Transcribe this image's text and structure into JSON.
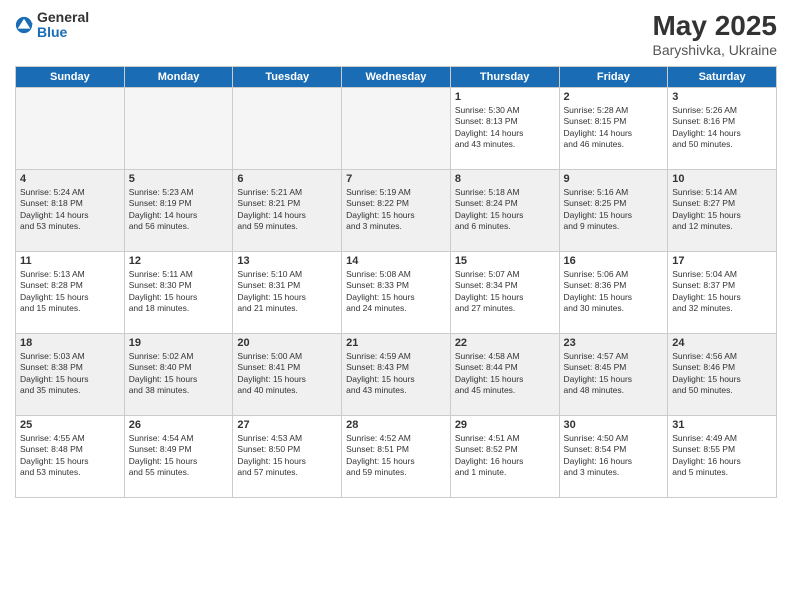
{
  "header": {
    "logo_general": "General",
    "logo_blue": "Blue",
    "month": "May 2025",
    "location": "Baryshivka, Ukraine"
  },
  "days_of_week": [
    "Sunday",
    "Monday",
    "Tuesday",
    "Wednesday",
    "Thursday",
    "Friday",
    "Saturday"
  ],
  "weeks": [
    [
      {
        "day": "",
        "info": "",
        "empty": true
      },
      {
        "day": "",
        "info": "",
        "empty": true
      },
      {
        "day": "",
        "info": "",
        "empty": true
      },
      {
        "day": "",
        "info": "",
        "empty": true
      },
      {
        "day": "1",
        "info": "Sunrise: 5:30 AM\nSunset: 8:13 PM\nDaylight: 14 hours\nand 43 minutes.",
        "empty": false
      },
      {
        "day": "2",
        "info": "Sunrise: 5:28 AM\nSunset: 8:15 PM\nDaylight: 14 hours\nand 46 minutes.",
        "empty": false
      },
      {
        "day": "3",
        "info": "Sunrise: 5:26 AM\nSunset: 8:16 PM\nDaylight: 14 hours\nand 50 minutes.",
        "empty": false
      }
    ],
    [
      {
        "day": "4",
        "info": "Sunrise: 5:24 AM\nSunset: 8:18 PM\nDaylight: 14 hours\nand 53 minutes.",
        "empty": false
      },
      {
        "day": "5",
        "info": "Sunrise: 5:23 AM\nSunset: 8:19 PM\nDaylight: 14 hours\nand 56 minutes.",
        "empty": false
      },
      {
        "day": "6",
        "info": "Sunrise: 5:21 AM\nSunset: 8:21 PM\nDaylight: 14 hours\nand 59 minutes.",
        "empty": false
      },
      {
        "day": "7",
        "info": "Sunrise: 5:19 AM\nSunset: 8:22 PM\nDaylight: 15 hours\nand 3 minutes.",
        "empty": false
      },
      {
        "day": "8",
        "info": "Sunrise: 5:18 AM\nSunset: 8:24 PM\nDaylight: 15 hours\nand 6 minutes.",
        "empty": false
      },
      {
        "day": "9",
        "info": "Sunrise: 5:16 AM\nSunset: 8:25 PM\nDaylight: 15 hours\nand 9 minutes.",
        "empty": false
      },
      {
        "day": "10",
        "info": "Sunrise: 5:14 AM\nSunset: 8:27 PM\nDaylight: 15 hours\nand 12 minutes.",
        "empty": false
      }
    ],
    [
      {
        "day": "11",
        "info": "Sunrise: 5:13 AM\nSunset: 8:28 PM\nDaylight: 15 hours\nand 15 minutes.",
        "empty": false
      },
      {
        "day": "12",
        "info": "Sunrise: 5:11 AM\nSunset: 8:30 PM\nDaylight: 15 hours\nand 18 minutes.",
        "empty": false
      },
      {
        "day": "13",
        "info": "Sunrise: 5:10 AM\nSunset: 8:31 PM\nDaylight: 15 hours\nand 21 minutes.",
        "empty": false
      },
      {
        "day": "14",
        "info": "Sunrise: 5:08 AM\nSunset: 8:33 PM\nDaylight: 15 hours\nand 24 minutes.",
        "empty": false
      },
      {
        "day": "15",
        "info": "Sunrise: 5:07 AM\nSunset: 8:34 PM\nDaylight: 15 hours\nand 27 minutes.",
        "empty": false
      },
      {
        "day": "16",
        "info": "Sunrise: 5:06 AM\nSunset: 8:36 PM\nDaylight: 15 hours\nand 30 minutes.",
        "empty": false
      },
      {
        "day": "17",
        "info": "Sunrise: 5:04 AM\nSunset: 8:37 PM\nDaylight: 15 hours\nand 32 minutes.",
        "empty": false
      }
    ],
    [
      {
        "day": "18",
        "info": "Sunrise: 5:03 AM\nSunset: 8:38 PM\nDaylight: 15 hours\nand 35 minutes.",
        "empty": false
      },
      {
        "day": "19",
        "info": "Sunrise: 5:02 AM\nSunset: 8:40 PM\nDaylight: 15 hours\nand 38 minutes.",
        "empty": false
      },
      {
        "day": "20",
        "info": "Sunrise: 5:00 AM\nSunset: 8:41 PM\nDaylight: 15 hours\nand 40 minutes.",
        "empty": false
      },
      {
        "day": "21",
        "info": "Sunrise: 4:59 AM\nSunset: 8:43 PM\nDaylight: 15 hours\nand 43 minutes.",
        "empty": false
      },
      {
        "day": "22",
        "info": "Sunrise: 4:58 AM\nSunset: 8:44 PM\nDaylight: 15 hours\nand 45 minutes.",
        "empty": false
      },
      {
        "day": "23",
        "info": "Sunrise: 4:57 AM\nSunset: 8:45 PM\nDaylight: 15 hours\nand 48 minutes.",
        "empty": false
      },
      {
        "day": "24",
        "info": "Sunrise: 4:56 AM\nSunset: 8:46 PM\nDaylight: 15 hours\nand 50 minutes.",
        "empty": false
      }
    ],
    [
      {
        "day": "25",
        "info": "Sunrise: 4:55 AM\nSunset: 8:48 PM\nDaylight: 15 hours\nand 53 minutes.",
        "empty": false
      },
      {
        "day": "26",
        "info": "Sunrise: 4:54 AM\nSunset: 8:49 PM\nDaylight: 15 hours\nand 55 minutes.",
        "empty": false
      },
      {
        "day": "27",
        "info": "Sunrise: 4:53 AM\nSunset: 8:50 PM\nDaylight: 15 hours\nand 57 minutes.",
        "empty": false
      },
      {
        "day": "28",
        "info": "Sunrise: 4:52 AM\nSunset: 8:51 PM\nDaylight: 15 hours\nand 59 minutes.",
        "empty": false
      },
      {
        "day": "29",
        "info": "Sunrise: 4:51 AM\nSunset: 8:52 PM\nDaylight: 16 hours\nand 1 minute.",
        "empty": false
      },
      {
        "day": "30",
        "info": "Sunrise: 4:50 AM\nSunset: 8:54 PM\nDaylight: 16 hours\nand 3 minutes.",
        "empty": false
      },
      {
        "day": "31",
        "info": "Sunrise: 4:49 AM\nSunset: 8:55 PM\nDaylight: 16 hours\nand 5 minutes.",
        "empty": false
      }
    ]
  ]
}
